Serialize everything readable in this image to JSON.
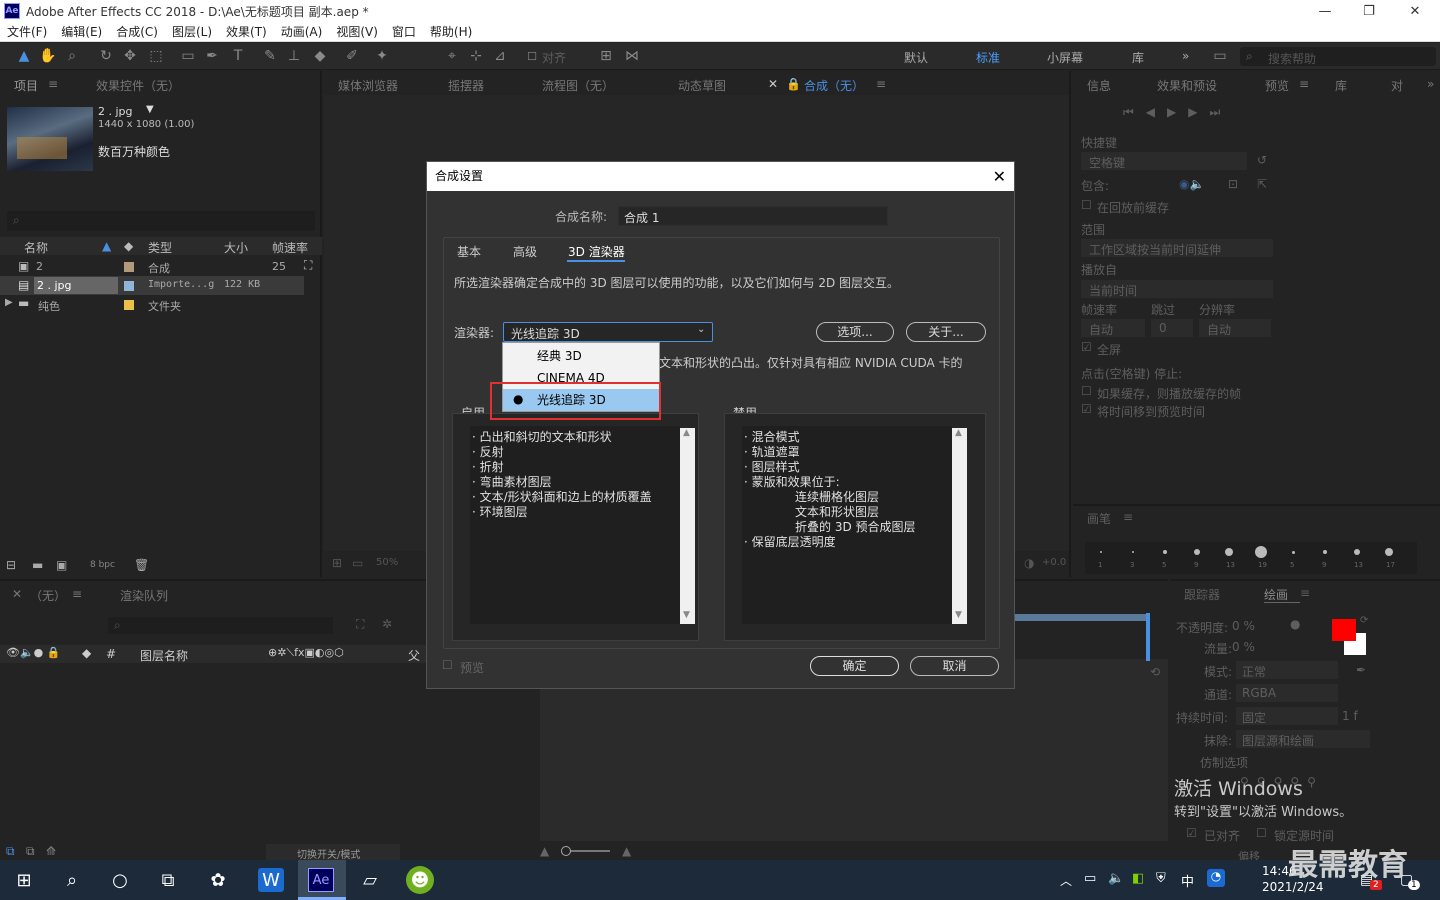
{
  "window": {
    "title": "Adobe After Effects CC 2018 - D:\\Ae\\无标题项目 副本.aep *",
    "logo": "Ae",
    "minimize": "—",
    "restore": "❐",
    "close": "✕"
  },
  "menu": [
    "文件(F)",
    "编辑(E)",
    "合成(C)",
    "图层(L)",
    "效果(T)",
    "动画(A)",
    "视图(V)",
    "窗口",
    "帮助(H)"
  ],
  "toolbar": {
    "align_label": "对齐",
    "workspaces": [
      "默认",
      "标准",
      "小屏幕",
      "库"
    ],
    "more": "»",
    "search_placeholder": "搜索帮助"
  },
  "project_panel": {
    "tab_project": "项目",
    "tab_effects": "效果控件（无）",
    "item_name": "2 . jpg",
    "item_dims": "1440 x 1080 (1.00)",
    "item_colors": "数百万种颜色",
    "columns": [
      "名称",
      "类型",
      "大小",
      "帧速率"
    ],
    "rows": [
      {
        "name": "2",
        "type": "合成",
        "size": "",
        "fps": "25",
        "color": "#b09a7a"
      },
      {
        "name": "2 . jpg",
        "type": "Importe...g",
        "size": "122 KB",
        "fps": "",
        "color": "#8fb5d9"
      },
      {
        "name": "纯色",
        "type": "文件夹",
        "size": "",
        "fps": "",
        "color": "#e8c04a"
      }
    ],
    "bpc": "8 bpc"
  },
  "viewer_tabs": [
    "媒体浏览器",
    "摇摆器",
    "流程图（无）",
    "动态草图",
    "合成（无）"
  ],
  "viewer_zoom": "50%",
  "viewer_offset": "+0.0",
  "right_panel": {
    "tabs": [
      "信息",
      "效果和预设",
      "预览",
      "库",
      "对"
    ],
    "shortcut_label": "快捷键",
    "shortcut_value": "空格键",
    "include_label": "包含:",
    "cache_label": "在回放前缓存",
    "range_label": "范围",
    "range_value": "工作区域按当前时间延伸",
    "play_from_label": "播放自",
    "play_from_value": "当前时间",
    "fps_label": "帧速率",
    "skip_label": "跳过",
    "res_label": "分辨率",
    "fps_value": "自动",
    "skip_value": "0",
    "res_value": "自动",
    "fullscreen_label": "全屏",
    "stop_label": "点击(空格键) 停止:",
    "if_cache_label": "如果缓存，则播放缓存的帧",
    "move_time_label": "将时间移到预览时间",
    "brush_tab": "画笔",
    "brush_sizes": [
      "1",
      "3",
      "5",
      "9",
      "13",
      "19",
      "5",
      "9",
      "13",
      "17"
    ]
  },
  "tracker_panel": {
    "tab_tracker": "跟踪器",
    "tab_paint": "绘画",
    "opacity_label": "不透明度:",
    "opacity_value": "0 %",
    "flow_label": "流量:",
    "flow_value": "0 %",
    "mode_label": "模式:",
    "mode_value": "正常",
    "channel_label": "通道:",
    "channel_value": "RGBA",
    "duration_label": "持续时间:",
    "duration_value": "固定",
    "erase_label": "抹除:",
    "erase_value": "图层源和绘画",
    "clone_label": "仿制选项",
    "aligned_label": "已对齐",
    "lock_time_label": "锁定源时间",
    "offset_label": "偏移",
    "frame_value": "1 f",
    "brush_color": "#ff0000"
  },
  "timeline": {
    "tab_none": "（无）",
    "tab_render": "渲染队列",
    "layer_name_col": "图层名称",
    "parent_col": "父",
    "switch_label": "切换开关/模式"
  },
  "dialog": {
    "title": "合成设置",
    "name_label": "合成名称:",
    "name_value": "合成 1",
    "tabs": [
      "基本",
      "高级",
      "3D 渲染器"
    ],
    "description": "所选渲染器确定合成中的 3D 图层可以使用的功能，以及它们如何与 2D 图层交互。",
    "renderer_label": "渲染器:",
    "renderer_value": "光线追踪 3D",
    "options_button": "选项...",
    "about_button": "关于...",
    "detail_text": "文本和形状的凸出。仅针对具有相应 NVIDIA CUDA 卡的",
    "dropdown_options": [
      "经典 3D",
      "CINEMA 4D",
      "光线追踪 3D"
    ],
    "enabled_label": "启用",
    "disabled_label": "禁用",
    "enabled_items": [
      "凸出和斜切的文本和形状",
      "反射",
      "折射",
      "弯曲素材图层",
      "文本/形状斜面和边上的材质覆盖",
      "环境图层"
    ],
    "disabled_items": [
      "混合模式",
      "轨道遮罩",
      "图层样式",
      "蒙版和效果位于:",
      "连续栅格化图层",
      "文本和形状图层",
      "折叠的 3D 预合成图层",
      "保留底层透明度"
    ],
    "preview_label": "预览",
    "ok_button": "确定",
    "cancel_button": "取消",
    "highlight_color": "#e03030"
  },
  "watermark": {
    "activate_title": "激活 Windows",
    "activate_sub": "转到\"设置\"以激活 Windows。",
    "brand": "最需教育"
  },
  "taskbar": {
    "time": "14:46",
    "date": "2021/2/24",
    "ime": "中",
    "notif_count": "2",
    "notif_badge2": "1"
  }
}
